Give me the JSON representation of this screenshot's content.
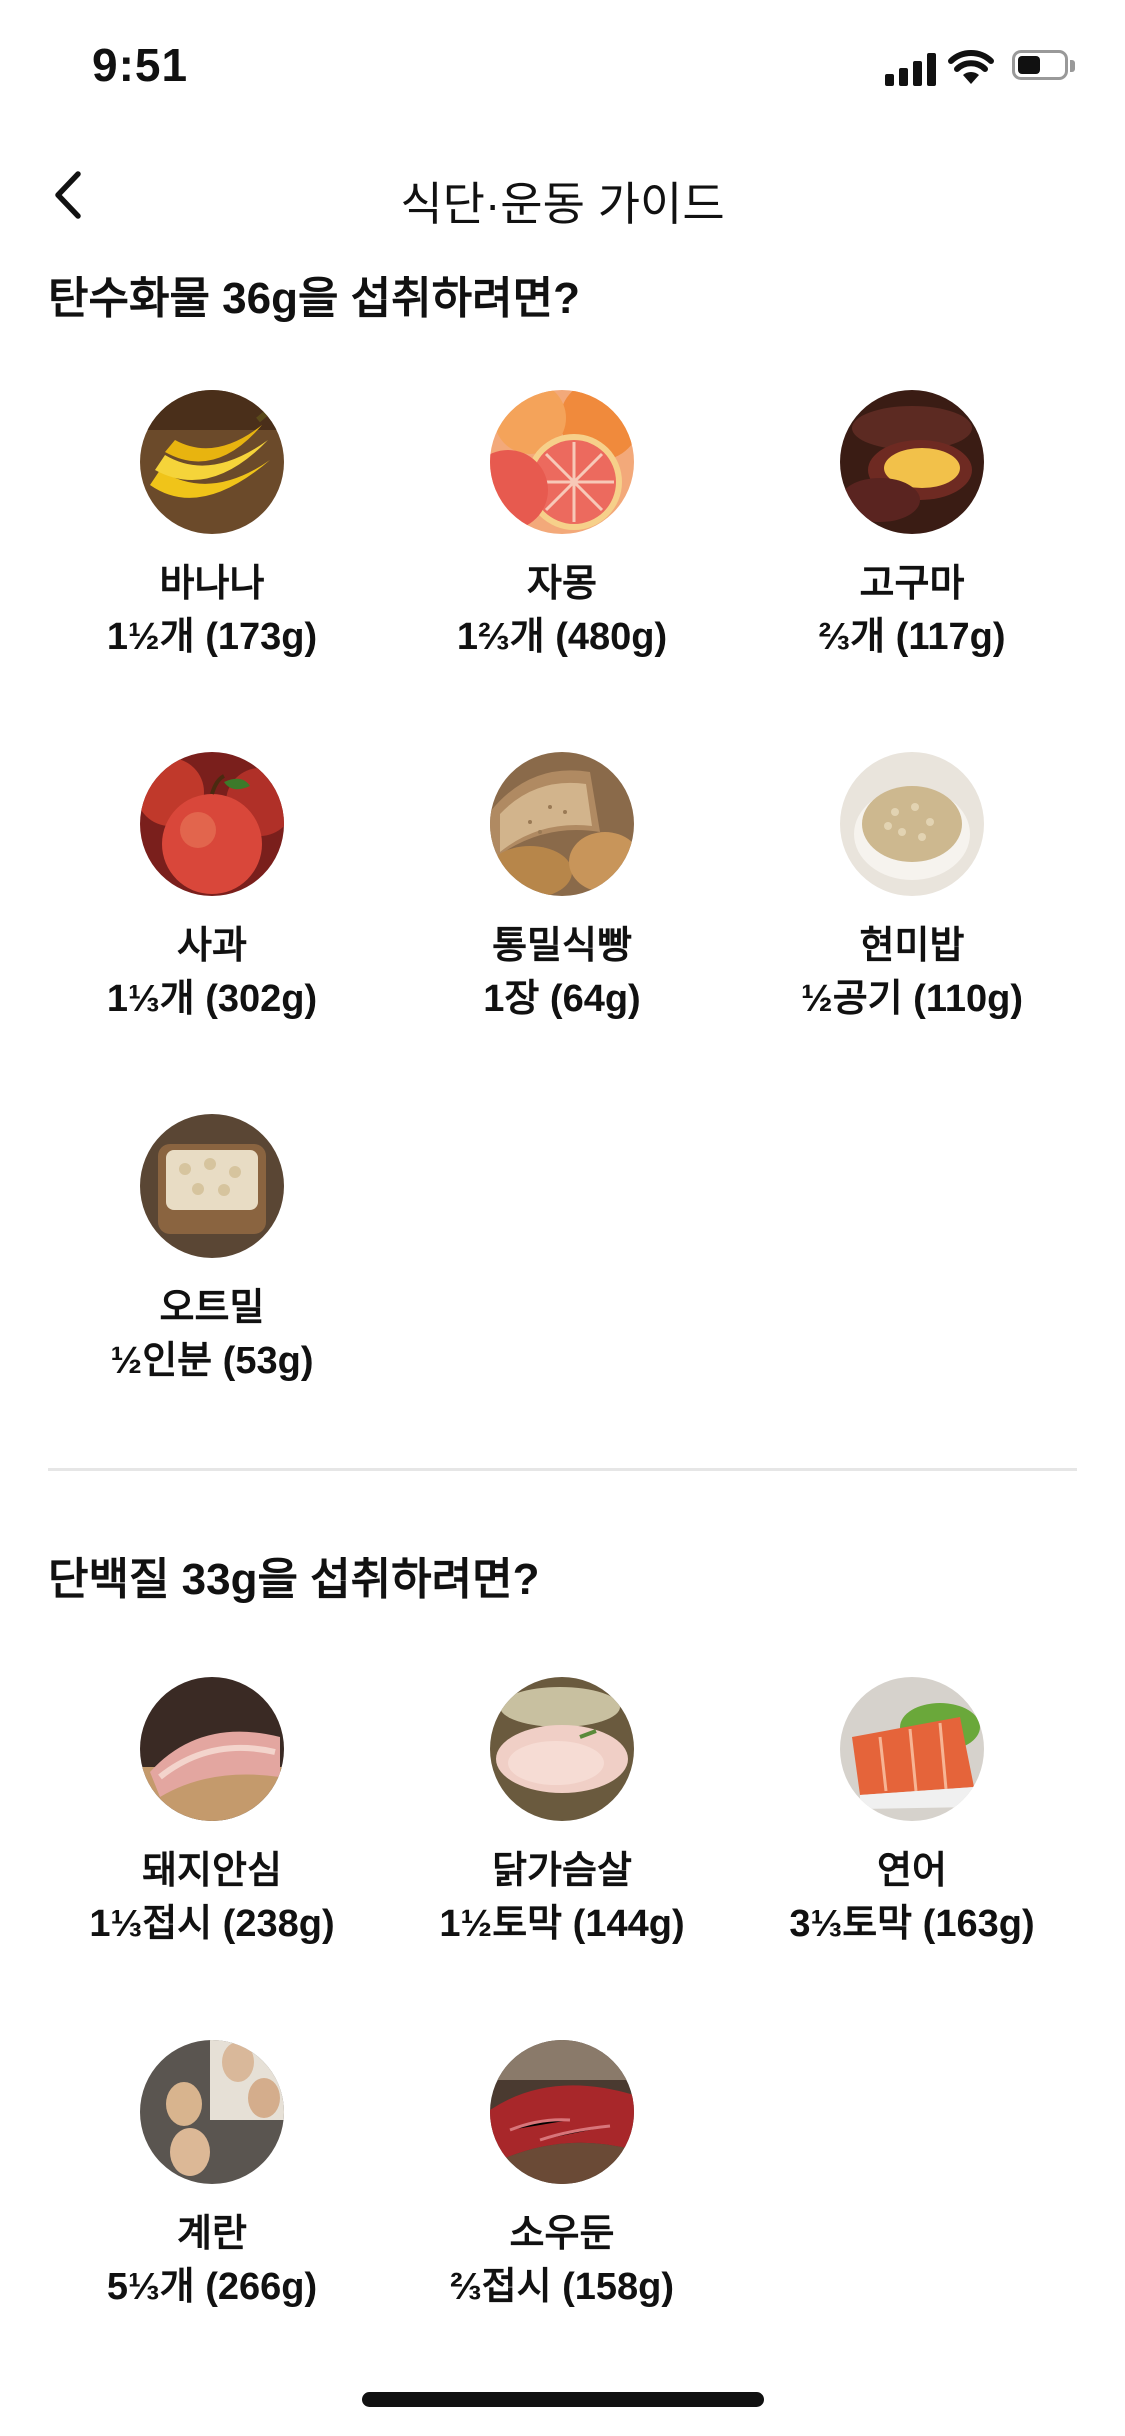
{
  "status_bar": {
    "time": "9:51"
  },
  "header": {
    "title": "식단·운동 가이드"
  },
  "carbs": {
    "title": "탄수화물 36g을 섭취하려면?",
    "items": [
      {
        "name": "바나나",
        "amount": "1½개 (173g)",
        "icon": "banana"
      },
      {
        "name": "자몽",
        "amount": "1⅔개 (480g)",
        "icon": "grapefruit"
      },
      {
        "name": "고구마",
        "amount": "⅔개 (117g)",
        "icon": "sweet-potato"
      },
      {
        "name": "사과",
        "amount": "1⅓개 (302g)",
        "icon": "apple"
      },
      {
        "name": "통밀식빵",
        "amount": "1장 (64g)",
        "icon": "whole-wheat-bread"
      },
      {
        "name": "현미밥",
        "amount": "½공기 (110g)",
        "icon": "brown-rice"
      },
      {
        "name": "오트밀",
        "amount": "½인분 (53g)",
        "icon": "oatmeal"
      }
    ]
  },
  "protein": {
    "title": "단백질 33g을 섭취하려면?",
    "items": [
      {
        "name": "돼지안심",
        "amount": "1⅓접시 (238g)",
        "icon": "pork-tenderloin"
      },
      {
        "name": "닭가슴살",
        "amount": "1½토막 (144g)",
        "icon": "chicken-breast"
      },
      {
        "name": "연어",
        "amount": "3⅓토막 (163g)",
        "icon": "salmon"
      },
      {
        "name": "계란",
        "amount": "5⅓개 (266g)",
        "icon": "egg"
      },
      {
        "name": "소우둔",
        "amount": "⅔접시 (158g)",
        "icon": "beef-round"
      }
    ]
  }
}
